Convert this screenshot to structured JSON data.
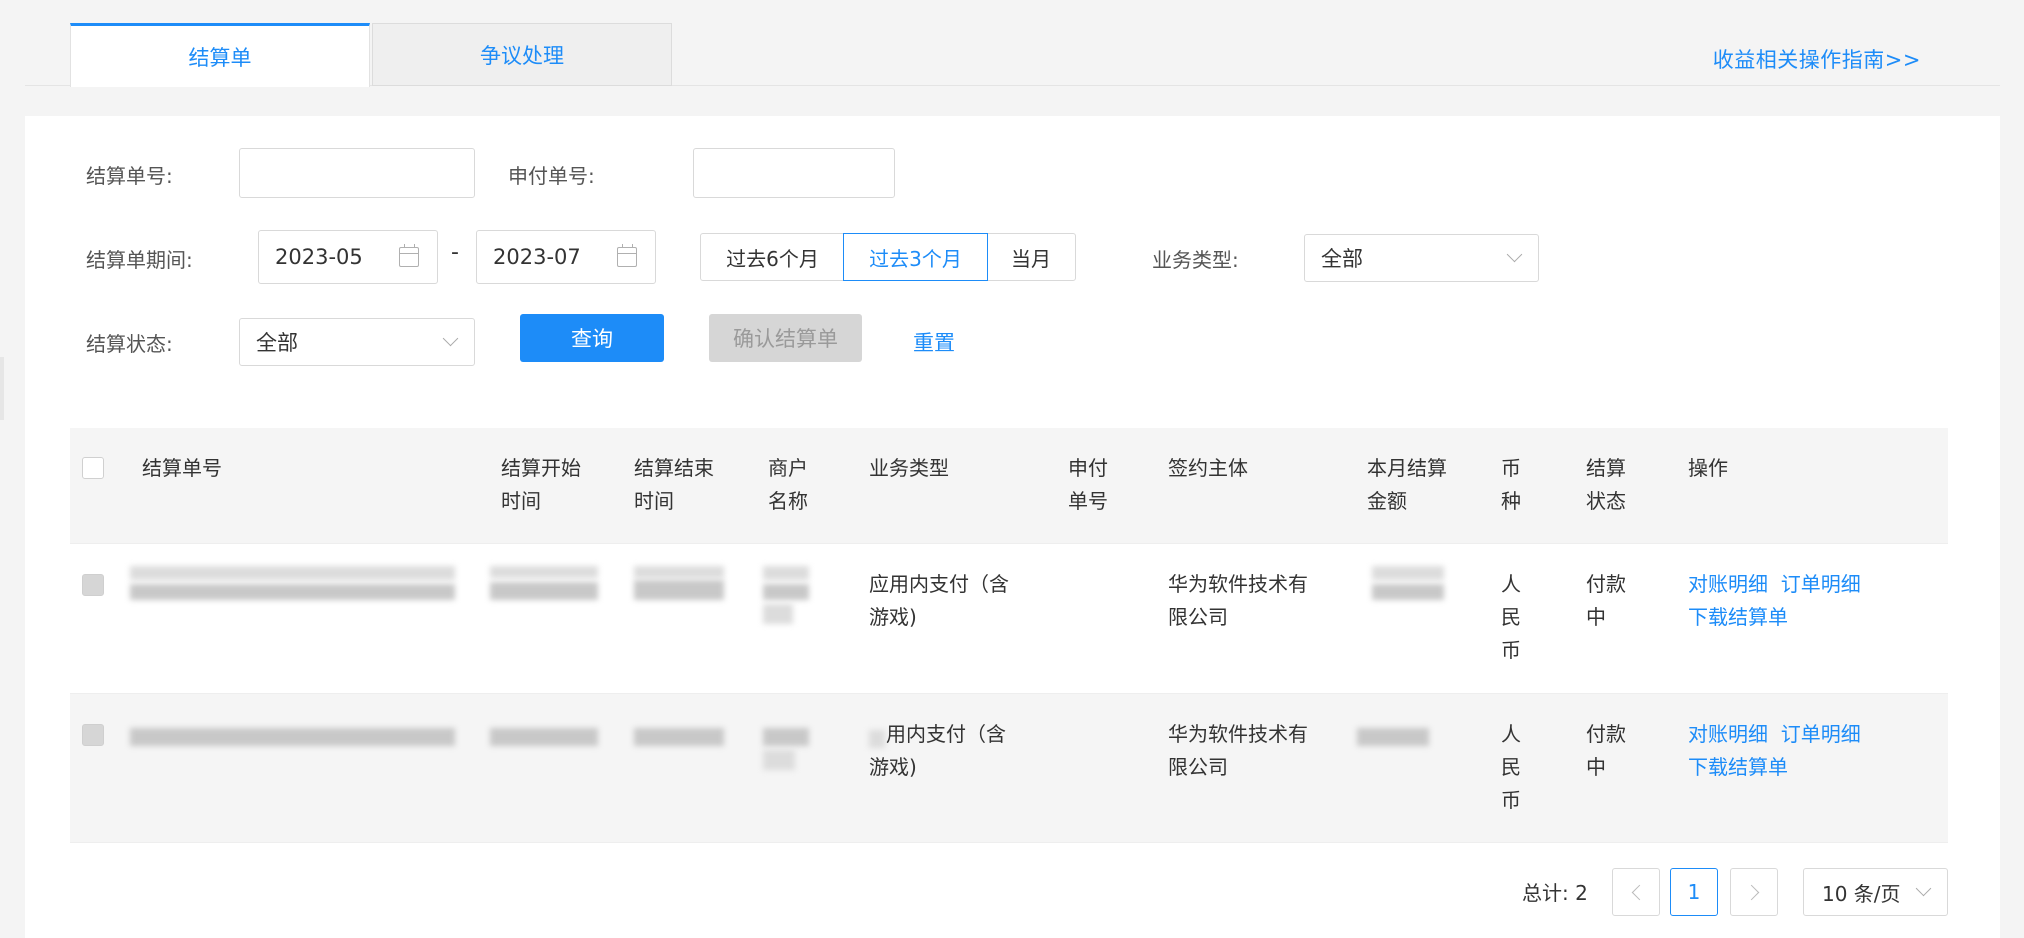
{
  "tabs": [
    {
      "label": "结算单",
      "active": true
    },
    {
      "label": "争议处理",
      "active": false
    }
  ],
  "guide_link": "收益相关操作指南>>",
  "filters": {
    "settlement_no_label": "结算单号:",
    "settlement_no_value": "",
    "payment_no_label": "申付单号:",
    "payment_no_value": "",
    "period_label": "结算单期间:",
    "period_start": "2023-05",
    "period_sep": "-",
    "period_end": "2023-07",
    "quick_ranges": [
      "过去6个月",
      "过去3个月",
      "当月"
    ],
    "quick_range_selected": "过去3个月",
    "biz_type_label": "业务类型:",
    "biz_type_value": "全部",
    "status_label": "结算状态:",
    "status_value": "全部",
    "query_button": "查询",
    "confirm_button": "确认结算单",
    "reset_link": "重置"
  },
  "table": {
    "headers": {
      "settlement_no": "结算单号",
      "start_line1": "结算开始",
      "start_line2": "时间",
      "end_line1": "结算结束",
      "end_line2": "时间",
      "merchant_line1": "商户",
      "merchant_line2": "名称",
      "biz_type": "业务类型",
      "payment_line1": "申付",
      "payment_line2": "单号",
      "entity": "签约主体",
      "amount_line1": "本月结算",
      "amount_line2": "金额",
      "currency_line1": "币",
      "currency_line2": "种",
      "status_line1": "结算",
      "status_line2": "状态",
      "actions": "操作"
    },
    "rows": [
      {
        "biz_type_line1": "应用内支付（含",
        "biz_type_line2": "游戏)",
        "entity_line1": "华为软件技术有",
        "entity_line2": "限公司",
        "currency": [
          "人",
          "民",
          "币"
        ],
        "status_line1": "付款",
        "status_line2": "中",
        "action_detail": "对账明细",
        "action_orders": "订单明细",
        "action_download": "下载结算单"
      },
      {
        "biz_type_line1": "用内支付（含",
        "biz_type_line2": "游戏)",
        "entity_line1": "华为软件技术有",
        "entity_line2": "限公司",
        "currency": [
          "人",
          "民",
          "币"
        ],
        "status_line1": "付款",
        "status_line2": "中",
        "action_detail": "对账明细",
        "action_orders": "订单明细",
        "action_download": "下载结算单"
      }
    ]
  },
  "pagination": {
    "total_label": "总计:",
    "total": "2",
    "current_page": "1",
    "page_size": "10 条/页"
  },
  "colors": {
    "accent": "#1d8cf8",
    "disabled_bg": "#d6d6d6"
  },
  "icons": [
    "calendar-icon",
    "chevron-down-icon",
    "chevron-left-icon",
    "chevron-right-icon"
  ]
}
